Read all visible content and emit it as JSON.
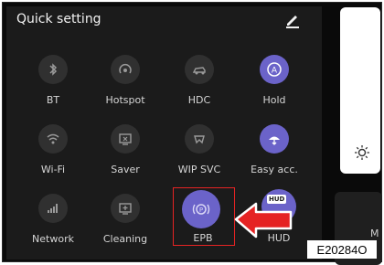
{
  "panel": {
    "title": "Quick setting"
  },
  "tiles": [
    {
      "label": "BT",
      "icon": "bluetooth-icon",
      "active": false
    },
    {
      "label": "Hotspot",
      "icon": "hotspot-icon",
      "active": false
    },
    {
      "label": "HDC",
      "icon": "hdc-icon",
      "active": false
    },
    {
      "label": "Hold",
      "icon": "hold-icon",
      "active": true
    },
    {
      "label": "Wi-Fi",
      "icon": "wifi-icon",
      "active": false
    },
    {
      "label": "Saver",
      "icon": "saver-icon",
      "active": false
    },
    {
      "label": "WIP SVC",
      "icon": "wip-svc-icon",
      "active": false
    },
    {
      "label": "Easy acc.",
      "icon": "easy-access-icon",
      "active": true
    },
    {
      "label": "Network",
      "icon": "network-signal-icon",
      "active": false
    },
    {
      "label": "Cleaning",
      "icon": "cleaning-icon",
      "active": false
    },
    {
      "label": "EPB",
      "icon": "epb-icon",
      "active": true
    },
    {
      "label": "HUD",
      "icon": "hud-icon",
      "active": true
    }
  ],
  "hud_badge": "HUD",
  "side_text": "M",
  "figure_code": "E20284O",
  "colors": {
    "active": "#6b63c9",
    "inactive": "#303030",
    "panel_bg": "#1b1b1b",
    "highlight": "#e52323"
  }
}
